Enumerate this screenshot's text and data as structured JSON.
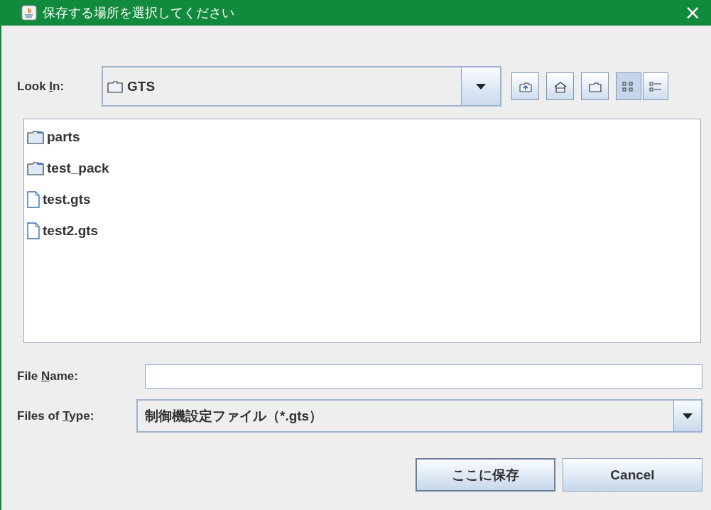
{
  "window": {
    "title": "保存する場所を選択してください",
    "close": "×"
  },
  "look_in": {
    "label_parts": [
      "Look ",
      "I",
      "n:"
    ],
    "value": "GTS"
  },
  "toolbar": [
    {
      "kind": "up",
      "selected": false
    },
    {
      "kind": "home",
      "selected": false
    },
    {
      "kind": "new-folder",
      "selected": false
    },
    {
      "kind": "list",
      "selected": true
    },
    {
      "kind": "details",
      "selected": false
    }
  ],
  "files": [
    {
      "name": "parts",
      "kind": "folder"
    },
    {
      "name": "test_pack",
      "kind": "folder"
    },
    {
      "name": "test.gts",
      "kind": "file"
    },
    {
      "name": "test2.gts",
      "kind": "file"
    }
  ],
  "file_name": {
    "label_parts": [
      "File ",
      "N",
      "ame:"
    ]
  },
  "file_type": {
    "label_parts": [
      "Files of ",
      "T",
      "ype:"
    ],
    "value": "制御機設定ファイル（*.gts）"
  },
  "buttons": [
    {
      "label": "ここに保存",
      "default": true
    },
    {
      "label": "Cancel",
      "default": false
    }
  ]
}
